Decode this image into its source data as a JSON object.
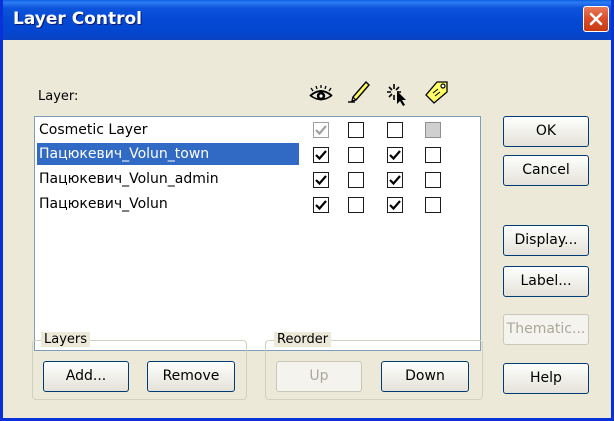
{
  "window": {
    "title": "Layer Control"
  },
  "list": {
    "header_label": "Layer:",
    "column_icons": [
      "visible-icon",
      "editable-icon",
      "selectable-icon",
      "label-icon"
    ],
    "rows": [
      {
        "name": "Cosmetic Layer",
        "selected": false,
        "visible": true,
        "editable": false,
        "selectable": false,
        "label": false,
        "visible_disabled": true,
        "label_disabled": true
      },
      {
        "name": "Пацюкевич_Volun_town",
        "selected": true,
        "visible": true,
        "editable": false,
        "selectable": true,
        "label": false
      },
      {
        "name": "Пацюкевич_Volun_admin",
        "selected": false,
        "visible": true,
        "editable": false,
        "selectable": true,
        "label": false
      },
      {
        "name": "Пацюкевич_Volun",
        "selected": false,
        "visible": true,
        "editable": false,
        "selectable": true,
        "label": false
      }
    ]
  },
  "buttons": {
    "ok": "OK",
    "cancel": "Cancel",
    "display": "Display...",
    "label": "Label...",
    "thematic": "Thematic...",
    "help": "Help"
  },
  "groups": {
    "layers": {
      "title": "Layers",
      "add": "Add...",
      "remove": "Remove"
    },
    "reorder": {
      "title": "Reorder",
      "up": "Up",
      "down": "Down"
    }
  },
  "colors": {
    "titlebar": "#0449d4",
    "selection": "#316ac5",
    "close": "#dd4f2a",
    "dialog_bg": "#ece9d8"
  }
}
